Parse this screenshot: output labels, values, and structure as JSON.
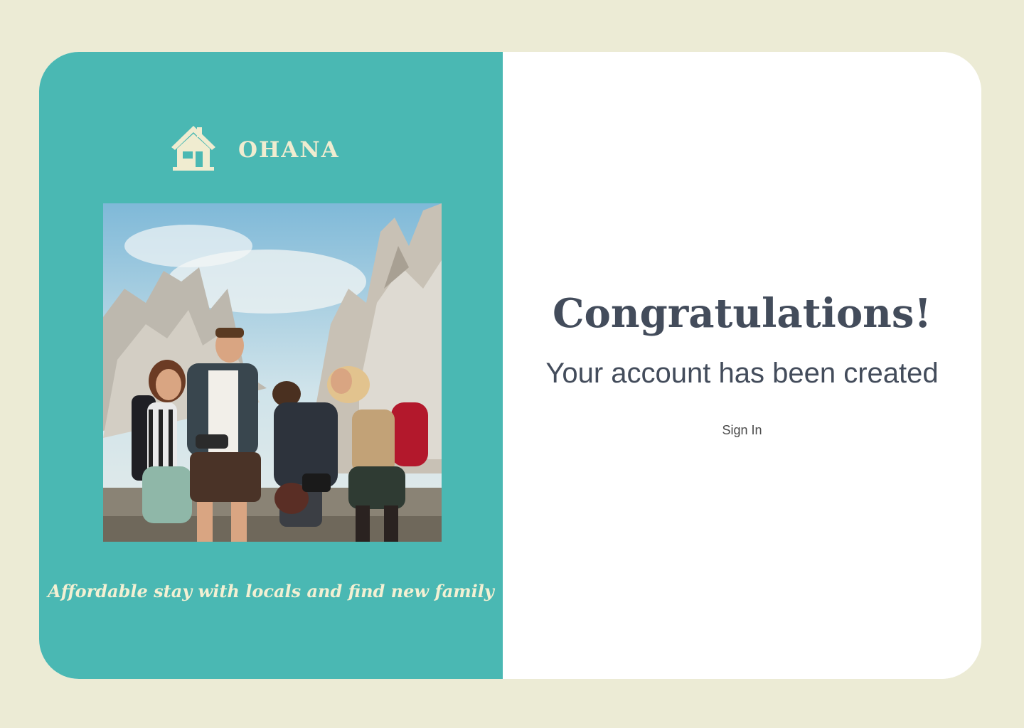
{
  "brand": {
    "name": "OHANA",
    "icon": "house-icon"
  },
  "hero": {
    "image": "group-of-hikers-in-mountains-photo",
    "tagline": "Affordable stay with locals and find new family"
  },
  "confirmation": {
    "title": "Congratulations!",
    "message": "Your account has been created",
    "sign_in_label": "Sign In"
  },
  "colors": {
    "page_background": "#ecebd5",
    "panel_teal": "#4ab8b3",
    "brand_cream": "#f0ecd0",
    "heading_slate": "#434c5b",
    "card_white": "#ffffff"
  }
}
